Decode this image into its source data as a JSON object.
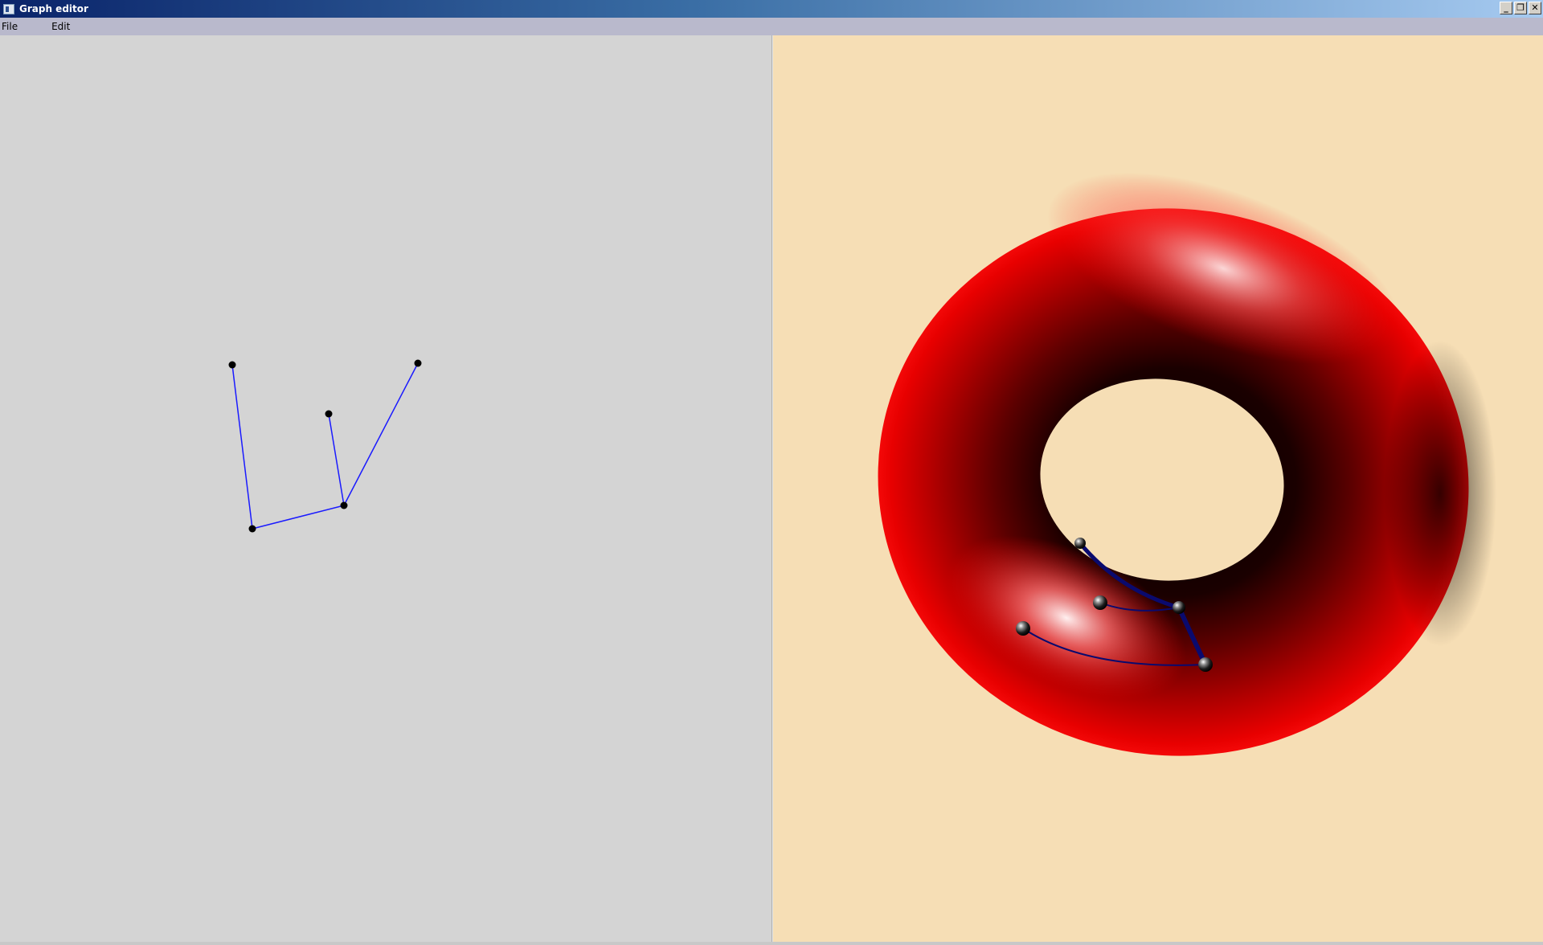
{
  "window": {
    "title": "Graph editor",
    "buttons": {
      "minimize": "_",
      "restore": "❐",
      "close": "✕"
    }
  },
  "menu": {
    "items": [
      "File",
      "Edit"
    ]
  },
  "colors": {
    "left_background": "#d4d4d4",
    "right_background": "#f6deb5",
    "edge_color": "#1a1aff",
    "node_color": "#000000",
    "torus_color": "#ff0000",
    "torus_edge_color": "#0a0a6e"
  },
  "graph": {
    "nodes": [
      {
        "id": "n1"
      },
      {
        "id": "n2"
      },
      {
        "id": "n3"
      },
      {
        "id": "n4"
      },
      {
        "id": "n5"
      },
      {
        "id": "n6"
      }
    ],
    "edges": [
      {
        "from": "n1",
        "to": "n4"
      },
      {
        "from": "n4",
        "to": "n5"
      },
      {
        "from": "n2",
        "to": "n5"
      },
      {
        "from": "n3",
        "to": "n5"
      }
    ]
  },
  "viewer_3d": {
    "surface": "torus"
  }
}
